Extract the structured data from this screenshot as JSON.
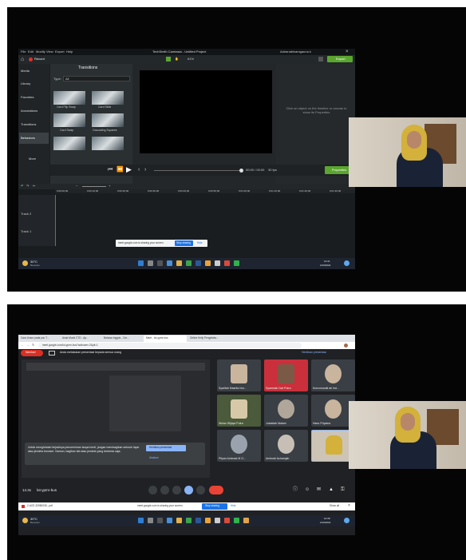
{
  "camtasia": {
    "menu": [
      "File",
      "Edit",
      "Modify",
      "View",
      "Export",
      "Help"
    ],
    "app_title": "TechSmith Camtasia - Untitled Project",
    "record_label": "Record",
    "account": "Adrianabinamgauna k",
    "export_label": "Export",
    "zoom": "61%",
    "sidebar": [
      "Media",
      "Library",
      "Favorites",
      "Annotations",
      "Transitions",
      "Behaviors",
      "More"
    ],
    "panel_title": "Transitions",
    "type_label": "Type:",
    "type_value": "All",
    "transitions": [
      "Card Flip Swap",
      "Card Slide",
      "Card Swap",
      "Cascading Squares"
    ],
    "properties_hint": "Click an object on the timeline or canvas to show its Properties",
    "timecode": "00:00 / 00:00",
    "fps": "30 fps",
    "properties_label": "Properties",
    "tracks": [
      "Track 2",
      "Track 1"
    ],
    "timeline_times": [
      "0:00:00;00",
      "0:00:10;00",
      "0:00:20;00",
      "0:00:30;00",
      "0:00:40;00",
      "0:00:50;00",
      "0:01:00;00",
      "0:01:10;00",
      "0:01:20;00",
      "0:01:30;00"
    ],
    "share_msg": "meet.google.com is sharing your screen.",
    "stop_sharing": "Stop sharing",
    "hide": "Hide",
    "weather": "30°C",
    "weather_sub": "Berawan",
    "clock_time": "14:41",
    "clock_date": "2/10/2022"
  },
  "meet": {
    "tabs": [
      "Cara Unsur pada you T...",
      "Anak Murid CTD - Ap...",
      "Bahasa Inggris - Cer...",
      "Meet - lot-ypmr-bus",
      "Online Kelly Pengetahu..."
    ],
    "url": "meet.google.com/lot-ypmr-bus?authuser=2&pli=1",
    "presenting_btn": "Membari",
    "presenting_msg": "Anda melakukan presentasi kepada semua orang",
    "stop_presenting": "Hentikan presentasi",
    "warning_text": "Untuk menghindari terjadinya pencerminan tanpa henti, jangan membagikan seluruh layar atau jendela browser. Namun, bagikan tab atau jendela yang berbeda saja.",
    "warning_btn1": "Hentikan presentasi",
    "warning_btn2": "Abaikan",
    "participants": [
      "Syarifah Masrita Nur...",
      "Syamsiah Dwi Putra",
      "Kuncorowati ah ind...",
      "Wulan Wijaya Putra",
      "Jubaidah Malam",
      "Hanu Priyatna",
      "Pityan Achmad M O...",
      "Amirnah Achamjah",
      ""
    ],
    "meeting_time": "14.3x",
    "meeting_code": "lot-ypmr-bus",
    "download_file": "2-ACE-32980035...pdf",
    "share_msg": "meet.google.com is sharing your screen.",
    "stop_sharing": "Stop sharing",
    "hide": "Hide",
    "show_all": "Show all",
    "weather": "30°C",
    "weather_sub": "Berawan",
    "clock_time": "14:38",
    "clock_date": "2/10/2022"
  },
  "colors": {
    "camtasia_green": "#5aa62e",
    "meet_red": "#d93025",
    "meet_blue": "#1a73e8",
    "hijab": "#d3b13a"
  }
}
